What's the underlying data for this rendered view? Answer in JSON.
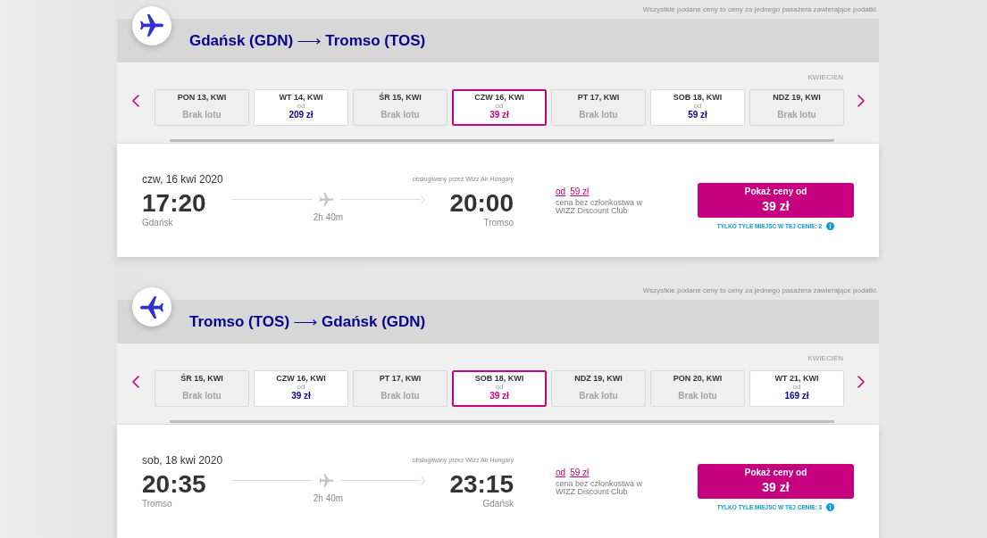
{
  "sections": [
    {
      "kind": "outbound",
      "notice": "Wszystkie podane ceny to ceny za jednego pasażera zawierające podatki.",
      "route": {
        "origin": "Gdańsk (GDN)",
        "destination": "Tromso (TOS)"
      },
      "month": "KWIECIEN",
      "dates": [
        {
          "kind": "no_flight",
          "label": "PON 13, KWI",
          "status": "Brak lotu",
          "selected": false
        },
        {
          "kind": "price",
          "label": "WT 14, KWI",
          "from": "od",
          "price": "209 zł",
          "selected": false
        },
        {
          "kind": "no_flight",
          "label": "ŚR 15, KWI",
          "status": "Brak lotu",
          "selected": false
        },
        {
          "kind": "price",
          "label": "CZW 16, KWI",
          "from": "od",
          "price": "39 zł",
          "selected": true
        },
        {
          "kind": "no_flight",
          "label": "PT 17, KWI",
          "status": "Brak lotu",
          "selected": false
        },
        {
          "kind": "price",
          "label": "SOB 18, KWI",
          "from": "od",
          "price": "59 zł",
          "selected": false
        },
        {
          "kind": "no_flight",
          "label": "NDZ 19, KWI",
          "status": "Brak lotu",
          "selected": false
        }
      ],
      "flight": {
        "date": "czw, 16 kwi 2020",
        "operator": "obsługiwany przez Wizz Air Hungary",
        "departure": {
          "time": "17:20",
          "city": "Gdańsk"
        },
        "duration": "2h 40m",
        "arrival": {
          "time": "20:00",
          "city": "Tromso"
        },
        "member_price": {
          "prefix": "od",
          "price": "59 zł",
          "note": "cena bez członkostwa w WIZZ Discount Club"
        },
        "button": {
          "label": "Pokaż ceny od",
          "price": "39 zł"
        },
        "seats_left": "TYLKO TYLE MIEJSC W TEJ CENIE: 2"
      }
    },
    {
      "kind": "return",
      "notice": "Wszystkie podane ceny to ceny za jednego pasażera zawierające podatki.",
      "route": {
        "origin": "Tromso (TOS)",
        "destination": "Gdańsk (GDN)"
      },
      "month": "KWIECIEN",
      "dates": [
        {
          "kind": "no_flight",
          "label": "ŚR 15, KWI",
          "status": "Brak lotu",
          "selected": false
        },
        {
          "kind": "price",
          "label": "CZW 16, KWI",
          "from": "od",
          "price": "39 zł",
          "selected": false
        },
        {
          "kind": "no_flight",
          "label": "PT 17, KWI",
          "status": "Brak lotu",
          "selected": false
        },
        {
          "kind": "price",
          "label": "SOB 18, KWI",
          "from": "od",
          "price": "39 zł",
          "selected": true
        },
        {
          "kind": "no_flight",
          "label": "NDZ 19, KWI",
          "status": "Brak lotu",
          "selected": false
        },
        {
          "kind": "no_flight",
          "label": "PON 20, KWI",
          "status": "Brak lotu",
          "selected": false
        },
        {
          "kind": "price",
          "label": "WT 21, KWI",
          "from": "od",
          "price": "169 zł",
          "selected": false
        }
      ],
      "flight": {
        "date": "sob, 18 kwi 2020",
        "operator": "obsługiwany przez Wizz Air Hungary",
        "departure": {
          "time": "20:35",
          "city": "Tromso"
        },
        "duration": "2h 40m",
        "arrival": {
          "time": "23:15",
          "city": "Gdańsk"
        },
        "member_price": {
          "prefix": "od",
          "price": "59 zł",
          "note": "cena bez członkostwa w WIZZ Discount Club"
        },
        "button": {
          "label": "Pokaż ceny od",
          "price": "39 zł"
        },
        "seats_left": "TYLKO TYLE MIEJSC W TEJ CENIE: 3"
      }
    }
  ]
}
